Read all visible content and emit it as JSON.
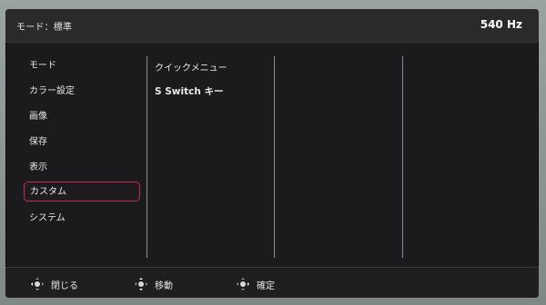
{
  "header": {
    "title": "モード：標準",
    "refresh_rate": "540 Hz"
  },
  "menu": {
    "items": [
      {
        "label": "モード"
      },
      {
        "label": "カラー設定"
      },
      {
        "label": "画像"
      },
      {
        "label": "保存"
      },
      {
        "label": "表示"
      },
      {
        "label": "カスタム",
        "selected": true
      },
      {
        "label": "システム"
      }
    ]
  },
  "submenu": {
    "items": [
      {
        "label": "クイックメニュー"
      },
      {
        "label": "S Switch キー"
      }
    ]
  },
  "footer": {
    "close_label": "閉じる",
    "move_label": "移動",
    "confirm_label": "確定",
    "close_icon": "joystick-left-icon",
    "move_icon": "joystick-updown-icon",
    "confirm_icon": "joystick-right-icon"
  },
  "colors": {
    "selection_border": "#c22d4f",
    "background": "#1b1b1d"
  }
}
